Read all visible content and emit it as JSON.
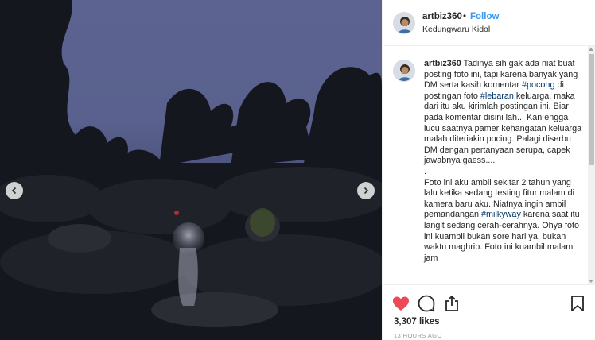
{
  "photo": {
    "prev_icon": "chevron-left-icon",
    "next_icon": "chevron-right-icon"
  },
  "header": {
    "username": "artbiz360",
    "separator": "•",
    "follow_label": "Follow",
    "location": "Kedungwaru Kidol"
  },
  "caption": {
    "username": "artbiz360",
    "segments": [
      {
        "text": " Tadinya sih gak ada niat buat posting foto ini, tapi karena banyak yang DM serta kasih komentar ",
        "tag": false
      },
      {
        "text": "#pocong",
        "tag": true
      },
      {
        "text": " di postingan foto ",
        "tag": false
      },
      {
        "text": "#lebaran",
        "tag": true
      },
      {
        "text": " keluarga, maka dari itu aku kirimlah postingan ini. Biar pada komentar disini lah... Kan engga lucu saatnya pamer kehangatan keluarga malah diteriakin pocing. Palagi diserbu DM dengan pertanyaan serupa, capek jawabnya gaess....\n.\nFoto ini aku ambil sekitar 2 tahun yang lalu ketika sedang testing fitur malam di kamera baru aku. Niatnya ingin ambil pemandangan ",
        "tag": false
      },
      {
        "text": "#milkyway",
        "tag": true
      },
      {
        "text": " karena saat itu langit sedang cerah-cerahnya. Ohya foto ini kuambil bukan sore hari ya, bukan waktu maghrib. Foto ini kuambil malam jam",
        "tag": false
      }
    ]
  },
  "actions": {
    "like_icon": "heart-icon",
    "comment_icon": "comment-icon",
    "share_icon": "share-icon",
    "save_icon": "bookmark-icon",
    "like_color": "#ed4956",
    "likes": "3,307 likes",
    "timestamp": "13 HOURS AGO"
  }
}
